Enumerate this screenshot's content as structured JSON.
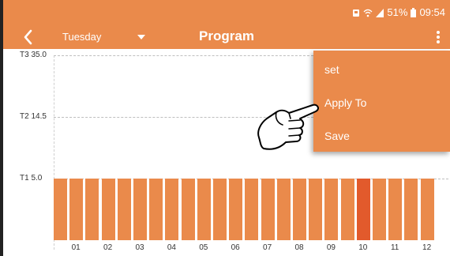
{
  "status": {
    "battery": "51%",
    "time": "09:54"
  },
  "header": {
    "day": "Tuesday",
    "title": "Program"
  },
  "chart_data": {
    "type": "bar",
    "ylabels": [
      "T3 35.0",
      "T2 14.5",
      "T1 5.0"
    ],
    "xticks": [
      "01",
      "02",
      "03",
      "04",
      "05",
      "06",
      "07",
      "08",
      "09",
      "10",
      "11",
      "12"
    ],
    "bar_count": 24,
    "values": [
      "T1",
      "T1",
      "T1",
      "T1",
      "T1",
      "T1",
      "T1",
      "T1",
      "T1",
      "T1",
      "T1",
      "T1",
      "T1",
      "T1",
      "T1",
      "T1",
      "T1",
      "T1",
      "T1",
      "T1",
      "T1",
      "T1",
      "T1",
      "T1"
    ],
    "active_index": 19,
    "colors": {
      "bar": "#ea8a4b",
      "active": "#e25a2c"
    }
  },
  "menu": {
    "items": [
      "set",
      "Apply To",
      "Save"
    ]
  },
  "colors": {
    "accent": "#ea8a4b"
  }
}
